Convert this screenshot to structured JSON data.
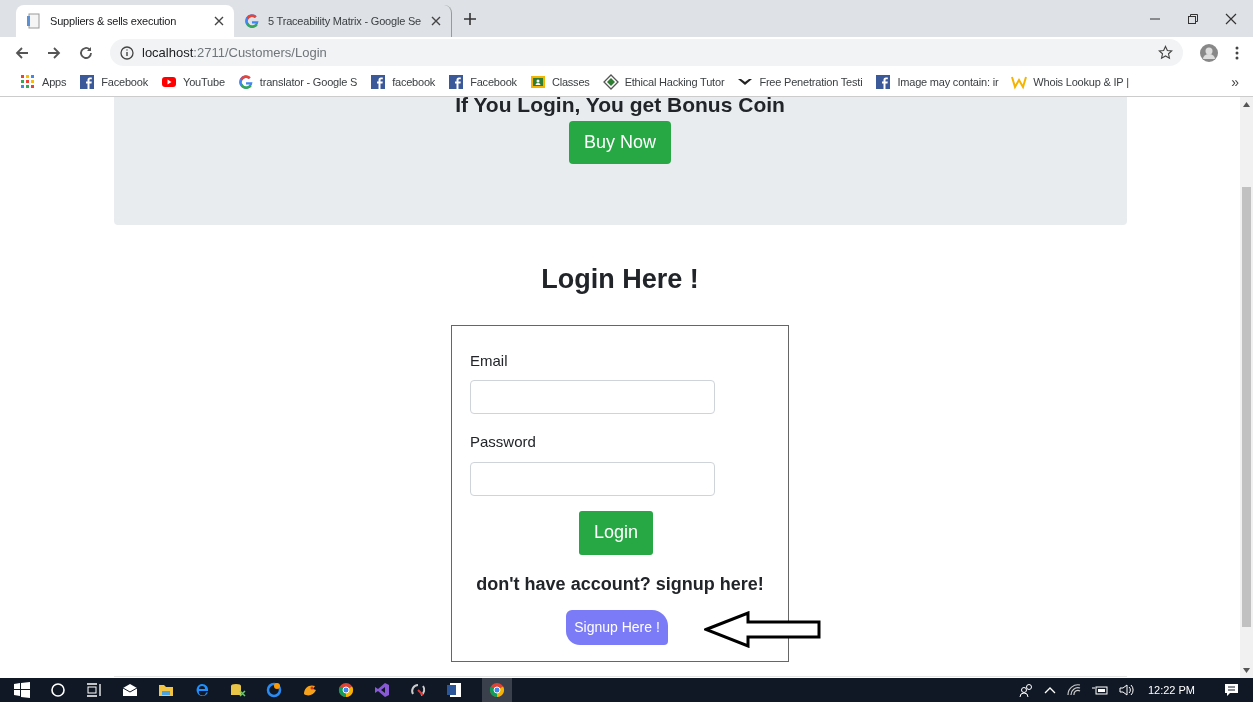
{
  "tabs": [
    {
      "title": "Suppliers & sells execution",
      "selected": true,
      "kind": "page"
    },
    {
      "title": "5 Traceability Matrix - Google Se",
      "selected": false,
      "kind": "google"
    }
  ],
  "address": {
    "host": "localhost",
    "path": ":2711/Customers/Login"
  },
  "bookmarks": [
    {
      "label": "Apps",
      "kind": "apps"
    },
    {
      "label": "Facebook",
      "kind": "facebook"
    },
    {
      "label": "YouTube",
      "kind": "youtube"
    },
    {
      "label": "translator - Google S",
      "kind": "google"
    },
    {
      "label": "facebook",
      "kind": "facebook"
    },
    {
      "label": "Facebook",
      "kind": "facebook"
    },
    {
      "label": "Classes",
      "kind": "classroom"
    },
    {
      "label": "Ethical Hacking Tutor",
      "kind": "diamond"
    },
    {
      "label": "Free Penetration Testi",
      "kind": "dash"
    },
    {
      "label": "Image may contain: ir",
      "kind": "facebook"
    },
    {
      "label": "Whois Lookup & IP |",
      "kind": "w"
    }
  ],
  "overflow": "»",
  "banner": {
    "heading": "If You Login, You get Bonus Coin",
    "button": "Buy Now"
  },
  "login": {
    "title": "Login Here !",
    "email_label": "Email",
    "password_label": "Password",
    "button": "Login",
    "prompt": "don't have account? signup here!",
    "signup_button": "Signup Here !"
  },
  "taskbar": {
    "time": "12:22 PM"
  }
}
